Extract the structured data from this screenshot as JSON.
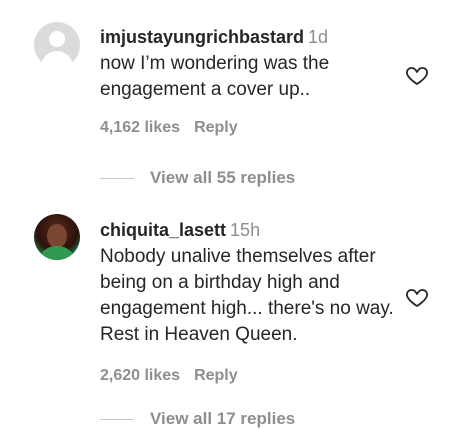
{
  "comments": [
    {
      "username": "imjustayungrichbastard",
      "time": "1d",
      "text": "now I’m wondering was the engagement a cover up..",
      "likes": "4,162 likes",
      "reply": "Reply",
      "view_replies": "View all 55 replies"
    },
    {
      "username": "chiquita_lasett",
      "time": "15h",
      "text": "Nobody unalive themselves after being on a birthday high and engagement high... there's no way. Rest in Heaven Queen.",
      "likes": "2,620 likes",
      "reply": "Reply",
      "view_replies": "View all 17 replies"
    }
  ]
}
